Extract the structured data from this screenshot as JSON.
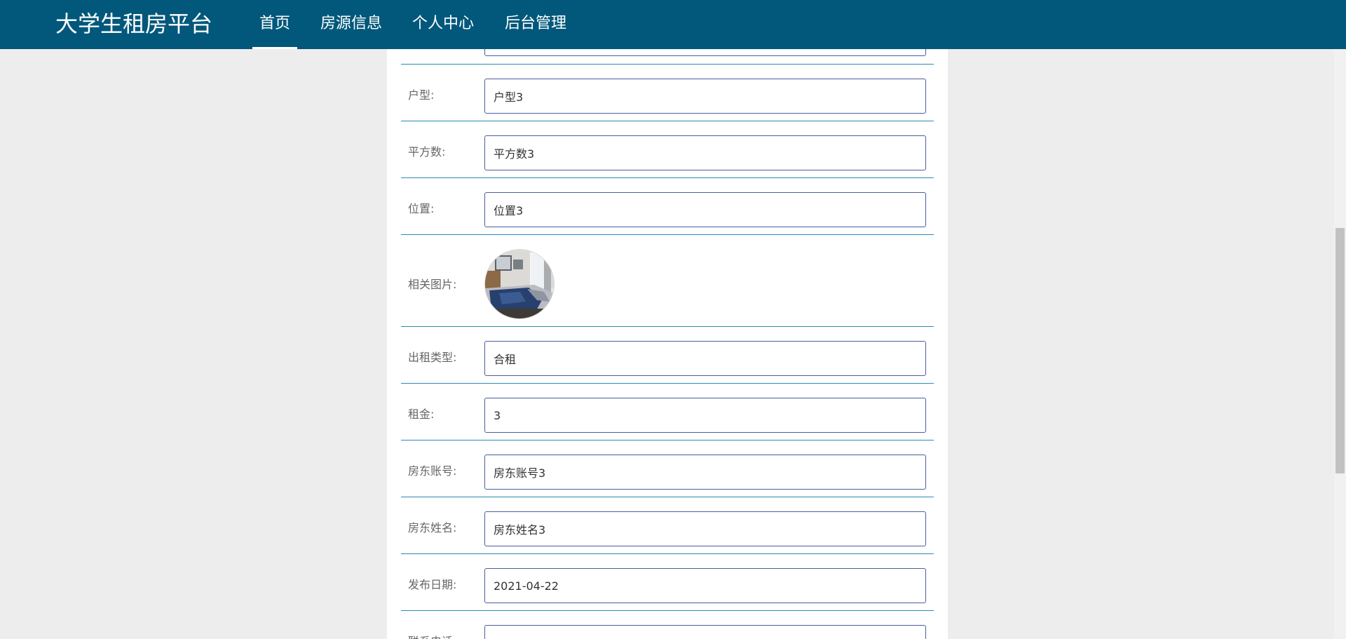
{
  "navbar": {
    "brand": "大学生租房平台",
    "items": [
      {
        "label": "首页",
        "active": true
      },
      {
        "label": "房源信息",
        "active": false
      },
      {
        "label": "个人中心",
        "active": false
      },
      {
        "label": "后台管理",
        "active": false
      }
    ]
  },
  "form": {
    "huxing": {
      "label": "户型:",
      "value": "户型3"
    },
    "area": {
      "label": "平方数:",
      "value": "平方数3"
    },
    "location": {
      "label": "位置:",
      "value": "位置3"
    },
    "photo": {
      "label": "相关图片:",
      "icon": "bedroom-photo"
    },
    "rent_type": {
      "label": "出租类型:",
      "value": "合租"
    },
    "rent": {
      "label": "租金:",
      "value": "3"
    },
    "landlord_account": {
      "label": "房东账号:",
      "value": "房东账号3"
    },
    "landlord_name": {
      "label": "房东姓名:",
      "value": "房东姓名3"
    },
    "publish_date": {
      "label": "发布日期:",
      "value": "2021-04-22"
    },
    "contact_phone": {
      "label": "联系电话:",
      "value": ""
    }
  },
  "colors": {
    "navbar": "#02587b",
    "row_divider": "#2a8bb0",
    "field_border": "#4a5f9c",
    "page_background": "#ededed"
  }
}
